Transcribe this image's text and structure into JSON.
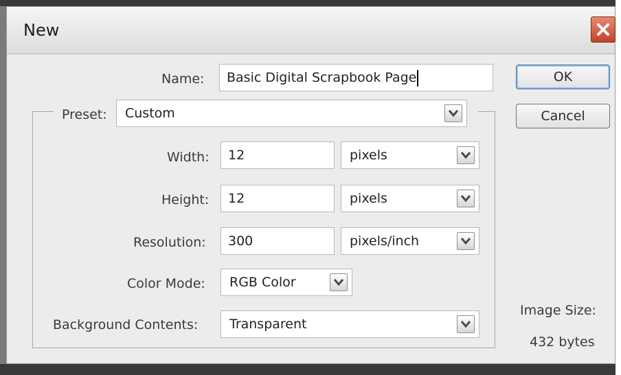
{
  "dialog": {
    "title": "New",
    "close_icon": "close-icon"
  },
  "form": {
    "name_label": "Name:",
    "name_value": "Basic Digital Scrapbook Page",
    "preset_label": "Preset:",
    "preset_value": "Custom",
    "width_label": "Width:",
    "width_value": "12",
    "width_unit": "pixels",
    "height_label": "Height:",
    "height_value": "12",
    "height_unit": "pixels",
    "resolution_label": "Resolution:",
    "resolution_value": "300",
    "resolution_unit": "pixels/inch",
    "color_mode_label": "Color Mode:",
    "color_mode_value": "RGB Color",
    "background_label": "Background Contents:",
    "background_value": "Transparent"
  },
  "buttons": {
    "ok_label": "OK",
    "cancel_label": "Cancel"
  },
  "image_size": {
    "label": "Image Size:",
    "value": "432 bytes"
  },
  "colors": {
    "close_button": "#c0432a",
    "default_button_outline": "#9cc1e6"
  }
}
